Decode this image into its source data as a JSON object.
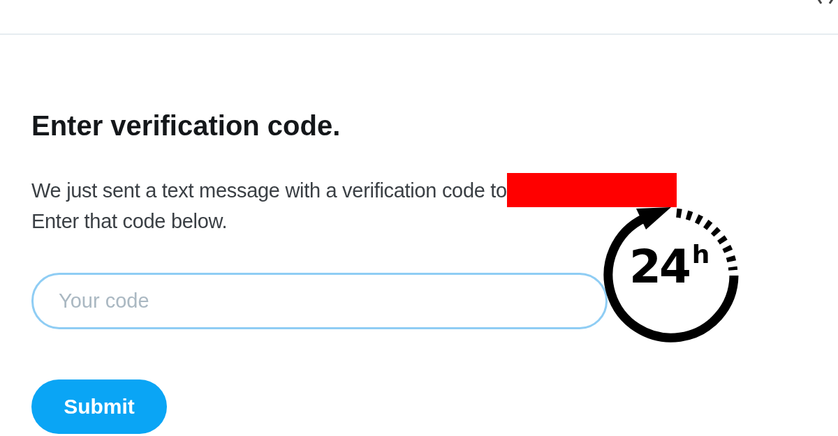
{
  "title": "Enter verification code.",
  "message": "We just sent a text message with a verification code to",
  "message_2": "Enter that code below.",
  "code_field": {
    "placeholder": "Your code"
  },
  "submit_button": "Submit",
  "badge": {
    "label": "24$^{h}$"
  }
}
